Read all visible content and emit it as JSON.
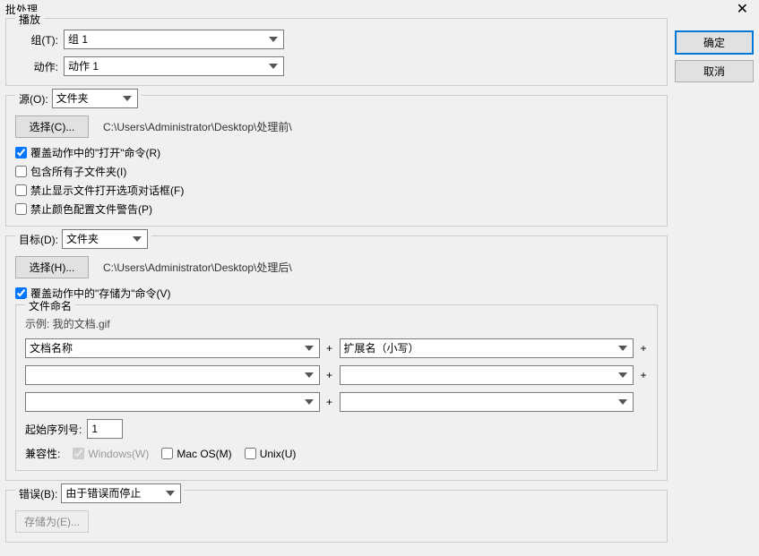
{
  "dialog": {
    "title": "批处理",
    "close": "✕"
  },
  "buttons": {
    "ok": "确定",
    "cancel": "取消"
  },
  "play": {
    "legend": "播放",
    "group_label": "组(T):",
    "group_value": "组 1",
    "action_label": "动作:",
    "action_value": "动作 1"
  },
  "source": {
    "legend": "源(O):",
    "select_value": "文件夹",
    "choose_btn": "选择(C)...",
    "path": "C:\\Users\\Administrator\\Desktop\\处理前\\",
    "override_open": "覆盖动作中的\"打开\"命令(R)",
    "include_subfolders": "包含所有子文件夹(I)",
    "suppress_open_options": "禁止显示文件打开选项对话框(F)",
    "suppress_color_warnings": "禁止颜色配置文件警告(P)"
  },
  "destination": {
    "legend": "目标(D):",
    "select_value": "文件夹",
    "choose_btn": "选择(H)...",
    "path": "C:\\Users\\Administrator\\Desktop\\处理后\\",
    "override_save": "覆盖动作中的\"存储为\"命令(V)"
  },
  "naming": {
    "legend": "文件命名",
    "example_label": "示例: ",
    "example_value": "我的文档.gif",
    "slot1a": "文档名称",
    "slot1b": "扩展名（小写）",
    "slot2a": "",
    "slot2b": "",
    "slot3a": "",
    "slot3b": "",
    "serial_label": "起始序列号:",
    "serial_value": "1",
    "compat_label": "兼容性:",
    "compat_win": "Windows(W)",
    "compat_mac": "Mac OS(M)",
    "compat_unix": "Unix(U)"
  },
  "errors": {
    "legend": "错误(B):",
    "select_value": "由于错误而停止",
    "save_as_btn": "存储为(E)..."
  }
}
